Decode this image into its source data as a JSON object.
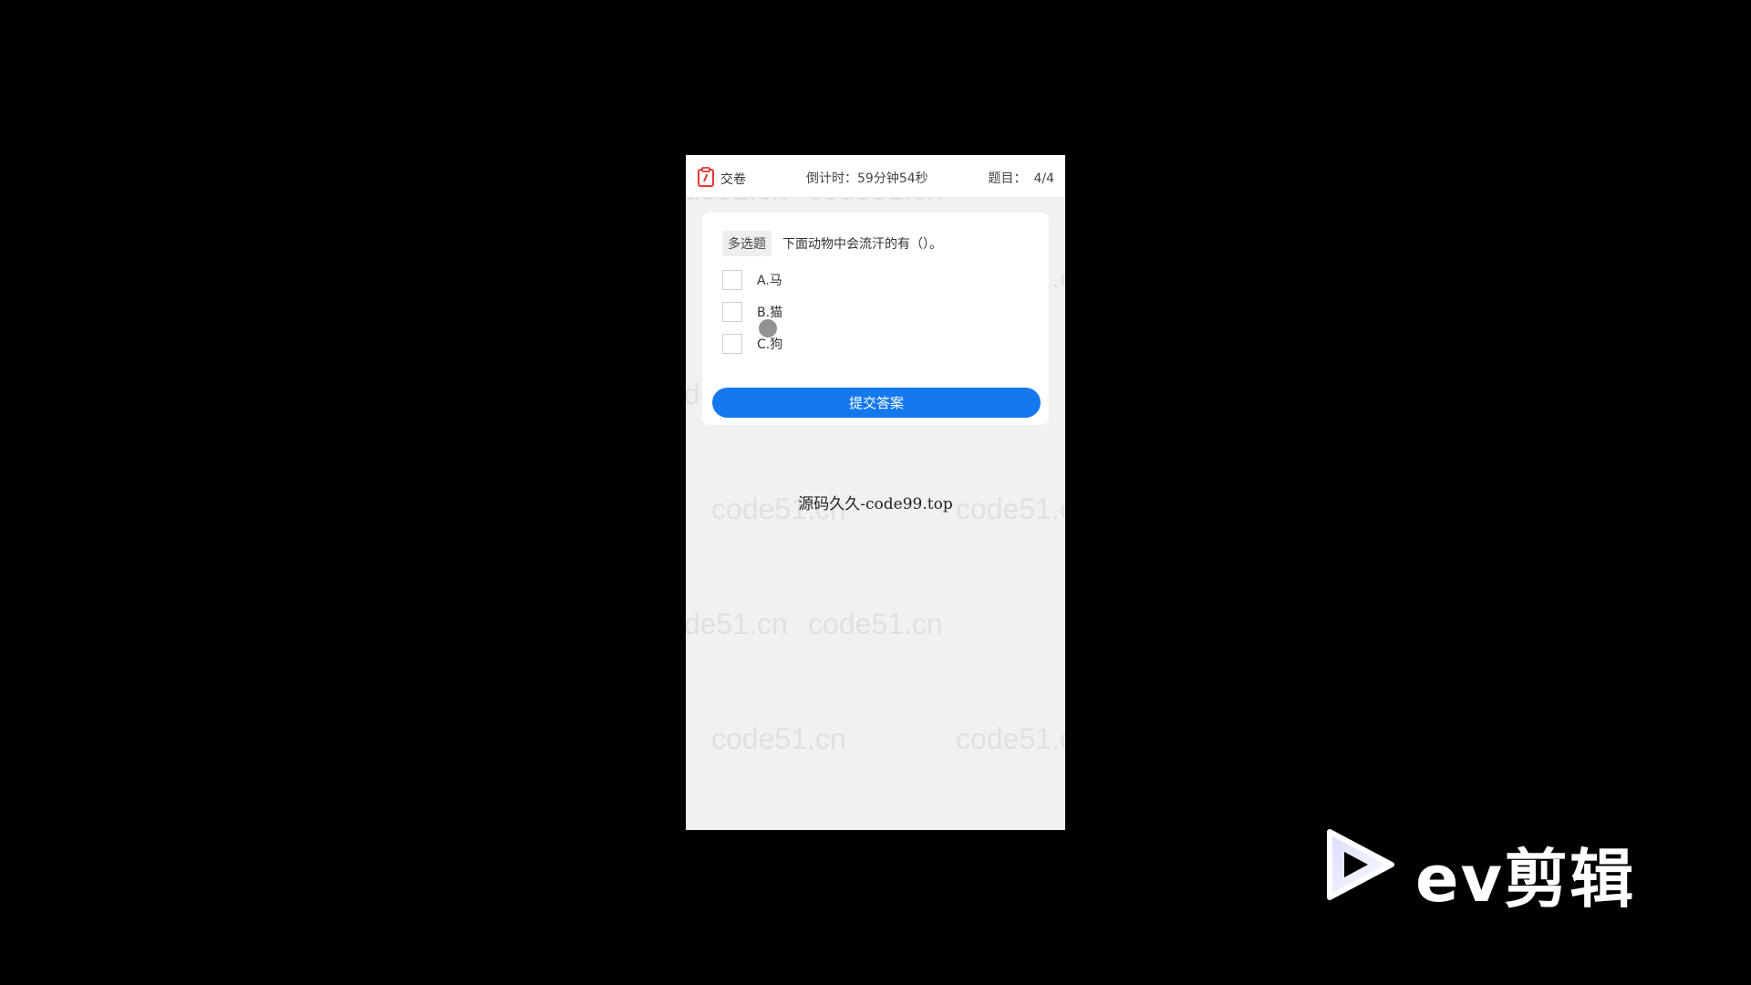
{
  "header": {
    "submit_paper_label": "交卷",
    "timer_text": "倒计时：59分钟54秒",
    "question_label": "题目：",
    "question_count": "4/4"
  },
  "question": {
    "type_badge": "多选题",
    "text": "下面动物中会流汗的有（）。",
    "options": [
      {
        "label": "A.马",
        "checked": false
      },
      {
        "label": "B.猫",
        "checked": false
      },
      {
        "label": "C.狗",
        "checked": false
      }
    ]
  },
  "submit_button_label": "提交答案",
  "site_text": "源码久久-code99.top",
  "watermark_text": "code51.cn",
  "logo": {
    "text": "ev剪辑"
  },
  "colors": {
    "accent": "#1479ef",
    "page_bg": "#f1f1f1",
    "outer_bg": "#000000",
    "icon_red": "#e53935"
  }
}
